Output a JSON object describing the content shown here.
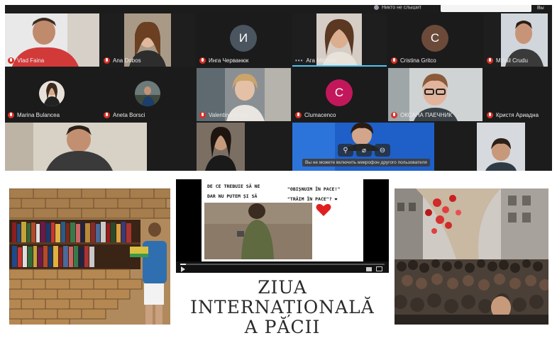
{
  "conference": {
    "notice_text": "Никто не слышит",
    "exit_label": "Вы",
    "participants_row1": [
      {
        "name": "Vlad Faina",
        "type": "video"
      },
      {
        "name": "Ana Dobos",
        "type": "video"
      },
      {
        "name": "Инга Черванюк",
        "type": "letter",
        "letter": "И",
        "color": "#4a5560"
      },
      {
        "name": "Ага Mihaela",
        "type": "video",
        "active": true
      },
      {
        "name": "Cristina Gritco",
        "type": "letter",
        "letter": "C",
        "color": "#6b4a3a"
      },
      {
        "name": "Mihail Crudu",
        "type": "video"
      }
    ],
    "participants_row2": [
      {
        "name": "Marina Bulancea",
        "type": "circle"
      },
      {
        "name": "Aneta Borsci",
        "type": "circle"
      },
      {
        "name": "Valentina Antoci",
        "type": "video"
      },
      {
        "name": "Clumacenco",
        "type": "letter",
        "letter": "C",
        "color": "#c2185b"
      },
      {
        "name": "ОКСАНА ПАЕЧНИК",
        "type": "video"
      },
      {
        "name": "Кристя Ариадна",
        "type": "plain"
      }
    ],
    "participants_row3": [
      {
        "name": "",
        "type": "video"
      },
      {
        "name": "",
        "type": "video"
      },
      {
        "name": "",
        "type": "video"
      },
      {
        "name": "",
        "type": "video"
      }
    ],
    "mic_hint": "Вы не можете включить микрофон другого пользователя",
    "controls": [
      "pin",
      "mic-off",
      "minus"
    ]
  },
  "video": {
    "question_line1": "DE CE TREBUIE SĂ NE",
    "question_line2": "DAR NU PUTEM ȘI SĂ",
    "quote_line1": "\"OBIȘNUIM ÎN PACE!\"",
    "quote_line2": "\"TRĂIM ÎN PACE\"? ❤"
  },
  "title": {
    "line1": "ZIUA",
    "line2": "INTERNAȚIONALĂ",
    "line3": "A PĂCII"
  },
  "colors": {
    "conference_bg": "#1c1c1c",
    "mic_muted": "#d93025",
    "active_speaker": "#4fc3f7"
  }
}
